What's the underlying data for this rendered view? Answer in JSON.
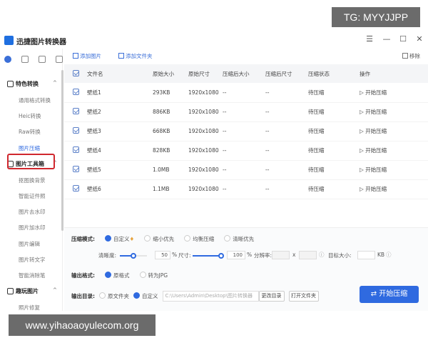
{
  "watermark_top": "TG: MYYJJPP",
  "watermark_bottom": "www.yihaoaoyulecom.org",
  "app": {
    "title": "迅捷图片转换器",
    "menu_icon": "☰",
    "min_icon": "—",
    "max_icon": "☐",
    "close_icon": "✕"
  },
  "sidebar": {
    "sections": [
      {
        "label": "特色转换",
        "items": [
          "通用格式转换",
          "Heic转换",
          "Raw转换",
          "图片压缩"
        ]
      },
      {
        "label": "图片工具箱",
        "items": [
          "抠图换背景",
          "智能证件照",
          "图片去水印",
          "图片加水印",
          "图片编辑",
          "图片转文字",
          "智能消除笔"
        ]
      },
      {
        "label": "趣玩图片",
        "items": [
          "照片修复"
        ]
      }
    ],
    "selected": "图片压缩"
  },
  "toolbar": {
    "add_image": "添加图片",
    "add_folder": "添加文件夹",
    "remove": "移除"
  },
  "table": {
    "headers": [
      "文件名",
      "原始大小",
      "原始尺寸",
      "压缩后大小",
      "压缩后尺寸",
      "压缩状态",
      "操作"
    ],
    "rows": [
      [
        "壁纸1",
        "293KB",
        "1920x1080",
        "--",
        "--",
        "待压缩",
        "开始压缩"
      ],
      [
        "壁纸2",
        "886KB",
        "1920x1080",
        "--",
        "--",
        "待压缩",
        "开始压缩"
      ],
      [
        "壁纸3",
        "668KB",
        "1920x1080",
        "--",
        "--",
        "待压缩",
        "开始压缩"
      ],
      [
        "壁纸4",
        "828KB",
        "1920x1080",
        "--",
        "--",
        "待压缩",
        "开始压缩"
      ],
      [
        "壁纸5",
        "1.0MB",
        "1920x1080",
        "--",
        "--",
        "待压缩",
        "开始压缩"
      ],
      [
        "壁纸6",
        "1.1MB",
        "1920x1080",
        "--",
        "--",
        "待压缩",
        "开始压缩"
      ]
    ]
  },
  "settings": {
    "mode_label": "压缩模式:",
    "modes": [
      "自定义",
      "缩小优先",
      "均衡压缩",
      "清晰优先"
    ],
    "clarity_label": "清晰度:",
    "clarity_value": "50",
    "pct": "%",
    "size_label": "尺寸:",
    "size_value": "100",
    "resolution_label": "分辨率:",
    "x": "x",
    "target_label": "目标大小:",
    "kb": "KB",
    "format_label": "输出格式:",
    "formats": [
      "原格式",
      "转为JPG"
    ],
    "dir_label": "输出目录:",
    "dirs": [
      "原文件夹",
      "自定义"
    ],
    "path": "C:\\Users\\Admin\\Desktop\\图片转换器",
    "change_dir": "更改目录",
    "open_folder": "打开文件夹",
    "start": "开始压缩"
  }
}
